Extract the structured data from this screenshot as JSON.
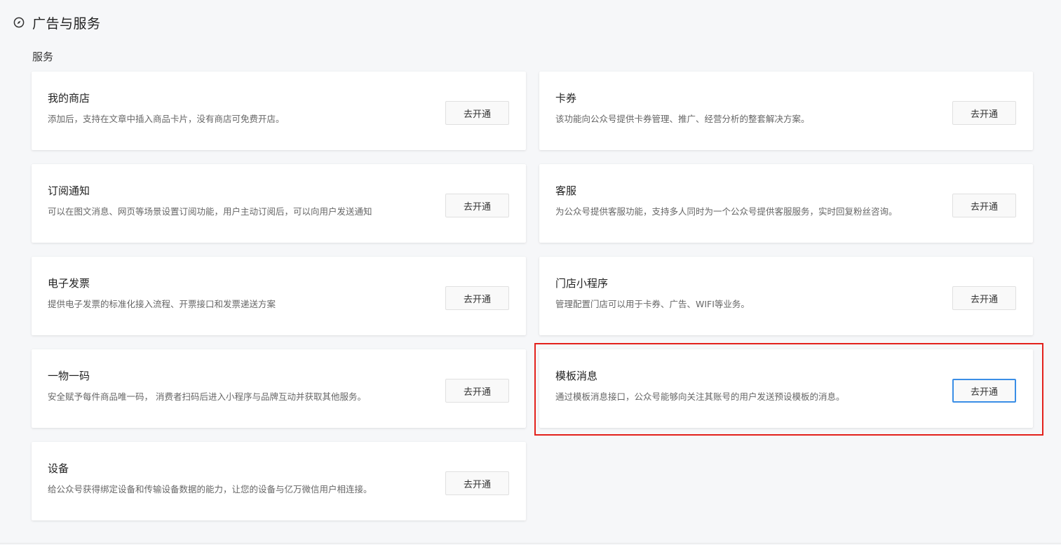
{
  "header": {
    "icon": "compass-icon",
    "title": "广告与服务"
  },
  "section": {
    "title": "服务"
  },
  "services": [
    {
      "title": "我的商店",
      "desc": "添加后，支持在文章中插入商品卡片，没有商店可免费开店。",
      "button": "去开通"
    },
    {
      "title": "卡券",
      "desc": "该功能向公众号提供卡券管理、推广、经营分析的整套解决方案。",
      "button": "去开通"
    },
    {
      "title": "订阅通知",
      "desc": "可以在图文消息、网页等场景设置订阅功能，用户主动订阅后，可以向用户发送通知",
      "button": "去开通"
    },
    {
      "title": "客服",
      "desc": "为公众号提供客服功能，支持多人同时为一个公众号提供客服服务，实时回复粉丝咨询。",
      "button": "去开通"
    },
    {
      "title": "电子发票",
      "desc": "提供电子发票的标准化接入流程、开票接口和发票递送方案",
      "button": "去开通"
    },
    {
      "title": "门店小程序",
      "desc": "管理配置门店可以用于卡券、广告、WIFI等业务。",
      "button": "去开通"
    },
    {
      "title": "一物一码",
      "desc": "安全赋予每件商品唯一码， 消费者扫码后进入小程序与品牌互动并获取其他服务。",
      "button": "去开通"
    },
    {
      "title": "模板消息",
      "desc": "通过模板消息接口，公众号能够向关注其账号的用户发送预设模板的消息。",
      "button": "去开通"
    },
    {
      "title": "设备",
      "desc": "给公众号获得绑定设备和传输设备数据的能力，让您的设备与亿万微信用户相连接。",
      "button": "去开通"
    }
  ],
  "colors": {
    "highlight": "#e3211c",
    "focus": "#3a8ee6"
  }
}
